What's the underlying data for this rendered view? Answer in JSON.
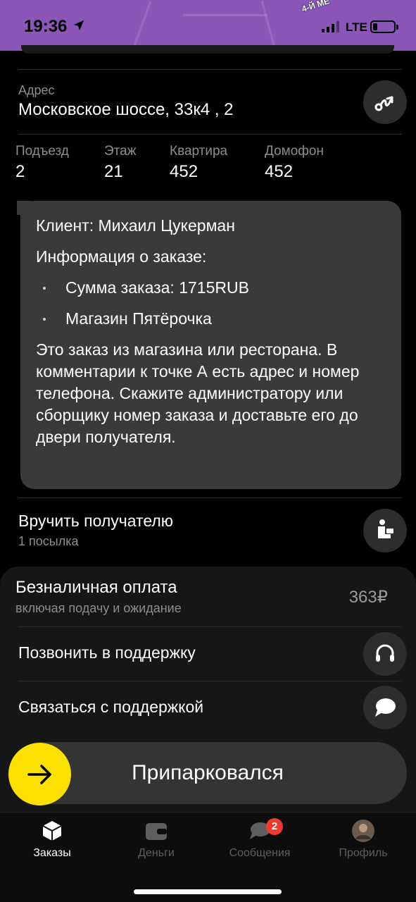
{
  "status_bar": {
    "time": "19:36",
    "network": "LTE",
    "map_label": "4-Й МЕ"
  },
  "address": {
    "label": "Адрес",
    "value": "Московское шоссе, 33к4 , 2",
    "route_icon": "route-icon"
  },
  "details": [
    {
      "label": "Подъезд",
      "value": "2"
    },
    {
      "label": "Этаж",
      "value": "21"
    },
    {
      "label": "Квартира",
      "value": "452"
    },
    {
      "label": "Домофон",
      "value": "452"
    }
  ],
  "message": {
    "client": "Клиент: Михаил Цукерман",
    "info_heading": "Информация о заказе:",
    "bullets": [
      "Сумма заказа: 1715RUB",
      "Магазин Пятёрочка"
    ],
    "body": "Это заказ из магазина или ресторана. В комментарии к точке А есть адрес и номер телефона. Скажите администратору или сборщику номер заказа и доставьте его до двери получателя."
  },
  "deliver": {
    "title": "Вручить получателю",
    "subtitle": "1 посылка"
  },
  "payment": {
    "title": "Безналичная оплата",
    "subtitle": "включая подачу и ожидание",
    "amount": "363₽"
  },
  "support": {
    "call_label": "Позвонить в поддержку",
    "chat_label": "Связаться с поддержкой"
  },
  "action": {
    "label": "Припарковался"
  },
  "tabs": [
    {
      "label": "Заказы",
      "active": true
    },
    {
      "label": "Деньги",
      "active": false
    },
    {
      "label": "Сообщения",
      "active": false
    },
    {
      "label": "Профиль",
      "active": false
    }
  ],
  "messages_badge": "2",
  "colors": {
    "accent_yellow": "#fce000",
    "map_purple": "#8a57b8",
    "badge_red": "#ef3b2f",
    "bubble_bg": "#3b3a38"
  }
}
